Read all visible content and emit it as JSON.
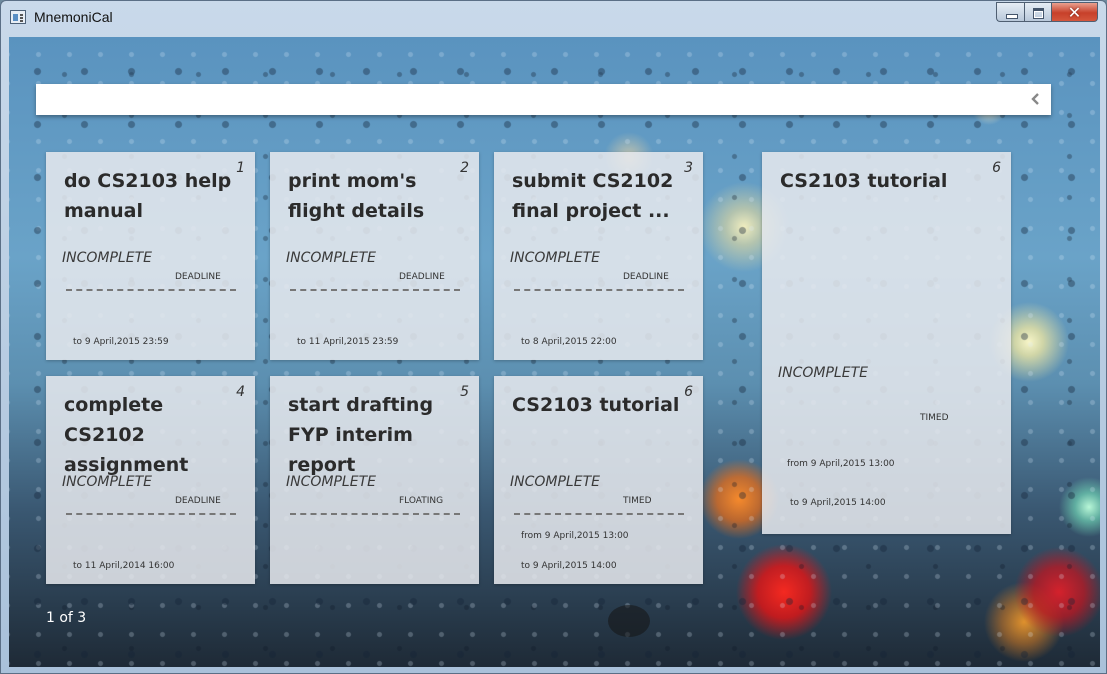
{
  "window": {
    "title": "MnemoniCal",
    "close_glyph": "✕"
  },
  "search": {
    "value": "",
    "placeholder": ""
  },
  "icons": {
    "app": "calendar-app-icon",
    "collapse": "chevron-left-icon"
  },
  "tasks": [
    {
      "num": "1",
      "title": "do CS2103 help manual",
      "status": "INCOMPLETE",
      "type": "DEADLINE",
      "to": "to 9 April,2015 23:59"
    },
    {
      "num": "2",
      "title": "print mom's flight details",
      "status": "INCOMPLETE",
      "type": "DEADLINE",
      "to": "to 11 April,2015 23:59"
    },
    {
      "num": "3",
      "title": "submit CS2102 final project ...",
      "status": "INCOMPLETE",
      "type": "DEADLINE",
      "to": "to 8 April,2015 22:00"
    },
    {
      "num": "4",
      "title": "complete CS2102 assignment",
      "status": "INCOMPLETE",
      "type": "DEADLINE",
      "to": "to 11 April,2014 16:00"
    },
    {
      "num": "5",
      "title": "start drafting FYP interim report",
      "status": "INCOMPLETE",
      "type": "FLOATING"
    },
    {
      "num": "6",
      "title": "CS2103 tutorial",
      "status": "INCOMPLETE",
      "type": "TIMED",
      "from": "from 9 April,2015 13:00",
      "to": "to 9 April,2015 14:00"
    }
  ],
  "detail": {
    "num": "6",
    "title": "CS2103 tutorial",
    "status": "INCOMPLETE",
    "type": "TIMED",
    "from": "from 9 April,2015 13:00",
    "to": "to 9 April,2015 14:00"
  },
  "pager": {
    "text": "1 of 3"
  }
}
